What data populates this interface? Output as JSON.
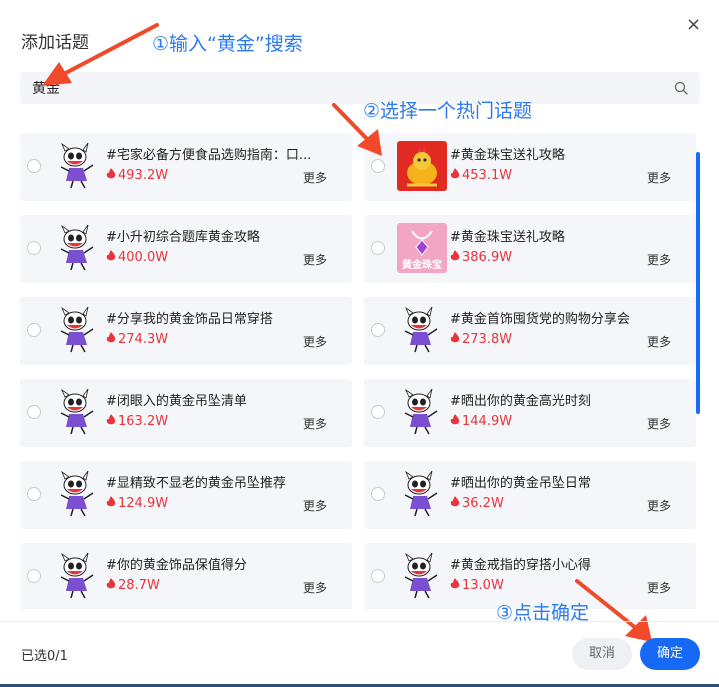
{
  "dialog": {
    "title": "添加话题",
    "close_label": "×"
  },
  "search": {
    "value": "黄金"
  },
  "annotations": {
    "step1": "①输入“黄金”搜索",
    "step2": "②选择一个热门话题",
    "step3": "③点击确定"
  },
  "topics": [
    {
      "title": "#宅家必备方便食品选购指南：口...",
      "heat": "493.2W",
      "more": "更多",
      "thumb": "mascot-icon"
    },
    {
      "title": "#黄金珠宝送礼攻略",
      "heat": "453.1W",
      "more": "更多",
      "thumb": "golden-rooster-image"
    },
    {
      "title": "#小升初综合题库黄金攻略",
      "heat": "400.0W",
      "more": "更多",
      "thumb": "mascot-icon"
    },
    {
      "title": "#黄金珠宝送礼攻略",
      "heat": "386.9W",
      "more": "更多",
      "thumb": "jewelry-logo",
      "thumb_text": "黄金珠宝"
    },
    {
      "title": "#分享我的黄金饰品日常穿搭",
      "heat": "274.3W",
      "more": "更多",
      "thumb": "mascot-icon"
    },
    {
      "title": "#黄金首饰囤货党的购物分享会",
      "heat": "273.8W",
      "more": "更多",
      "thumb": "mascot-icon"
    },
    {
      "title": "#闭眼入的黄金吊坠清单",
      "heat": "163.2W",
      "more": "更多",
      "thumb": "mascot-icon"
    },
    {
      "title": "#晒出你的黄金高光时刻",
      "heat": "144.9W",
      "more": "更多",
      "thumb": "mascot-icon"
    },
    {
      "title": "#显精致不显老的黄金吊坠推荐",
      "heat": "124.9W",
      "more": "更多",
      "thumb": "mascot-icon"
    },
    {
      "title": "#晒出你的黄金吊坠日常",
      "heat": "36.2W",
      "more": "更多",
      "thumb": "mascot-icon"
    },
    {
      "title": "#你的黄金饰品保值得分",
      "heat": "28.7W",
      "more": "更多",
      "thumb": "mascot-icon"
    },
    {
      "title": "#黄金戒指的穿搭小心得",
      "heat": "13.0W",
      "more": "更多",
      "thumb": "mascot-icon"
    }
  ],
  "footer": {
    "selected_count": "已选0/1",
    "cancel_label": "取消",
    "confirm_label": "确定"
  },
  "colors": {
    "accent": "#1669f5",
    "heat": "#e8343a",
    "annotation": "#2b7af0",
    "arrow": "#f04a2a"
  }
}
